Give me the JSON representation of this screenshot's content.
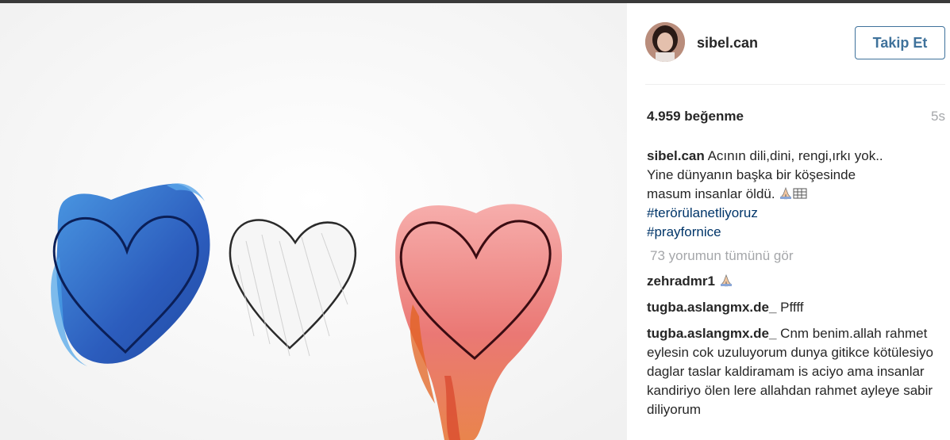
{
  "post": {
    "author": "sibel.can",
    "follow_label": "Takip Et",
    "likes": "4.959 beğenme",
    "time_ago": "5s",
    "caption_user": "sibel.can",
    "caption_text": "Acının dili,dini, rengi,ırkı yok..\nYine dünyanın başka bir köşesinde\nmasum insanlar öldü.",
    "hashtags": [
      "#terörülanetliyoruz",
      "#prayfornice"
    ],
    "view_all_comments": "73 yorumun tümünü gör"
  },
  "comments": [
    {
      "user": "zehradmr1",
      "text": ""
    },
    {
      "user": "tugba.aslangmx.de_",
      "text": "Pffff"
    },
    {
      "user": "tugba.aslangmx.de_",
      "text": "Cnm benim.allah rahmet eylesin cok uzuluyorum dunya gitikce kötülesiyo daglar taslar kaldiramam is aciyo ama insanlar kandiriyo ölen lere allahdan rahmet ayleye sabir diliyorum"
    }
  ],
  "colors": {
    "link": "#003569",
    "follow": "#3f729b",
    "muted": "#a5a7aa",
    "heart_blue": "#1f5fc0",
    "heart_red": "#e3565a"
  },
  "icons": [
    "praying-hands-emoji",
    "flag-emoji"
  ]
}
